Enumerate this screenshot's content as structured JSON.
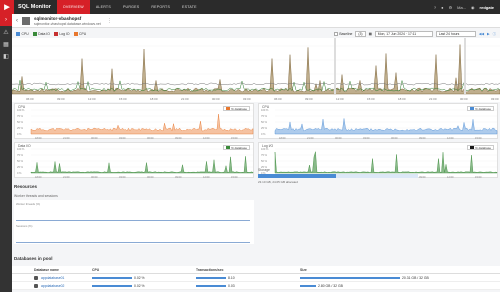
{
  "topbar": {
    "brand": "SQL Monitor",
    "nav": [
      "OVERVIEW",
      "ALERTS",
      "PURGES",
      "REPORTS",
      "ESTATE"
    ],
    "active_index": 0,
    "user": "Ma...",
    "company": "redgate"
  },
  "header": {
    "title": "sqlmonitor-vbashopsf",
    "subtitle": "sqlmonitor-vbashopsf.database.windows.net"
  },
  "toolbar": {
    "series": [
      {
        "label": "CPU",
        "color": "#4a8bd4"
      },
      {
        "label": "Data IO",
        "color": "#3a8a3a"
      },
      {
        "label": "Log IO",
        "color": "#c63030"
      },
      {
        "label": "CPU",
        "color": "#e8772e"
      }
    ],
    "baseline_label": "Baseline",
    "baseline_value": "(3)",
    "date_value": "Mon, 17 Jun 2024 · 17:11",
    "range_value": "Last 24 hours"
  },
  "overview_times": [
    "06:00",
    "09:00",
    "12:00",
    "15:00",
    "18:00",
    "21:00",
    "00:00",
    "03:00",
    "06:00",
    "09:00",
    "12:00",
    "15:00",
    "18:00",
    "21:00",
    "00:00",
    "03:00"
  ],
  "panels": {
    "cpu_left": {
      "title": "CPU",
      "legend": "% database",
      "color": "#e8772e",
      "yticks": [
        "100 %",
        "75 %",
        "50 %",
        "25 %",
        "0 %"
      ]
    },
    "cpu_right": {
      "title": "CPU",
      "legend": "% database",
      "color": "#4a8bd4",
      "yticks": [
        "100 %",
        "75 %",
        "50 %",
        "25 %",
        "0 %"
      ]
    },
    "data_io": {
      "title": "Data I/O",
      "legend": "% database",
      "color": "#3a8a3a",
      "yticks": [
        "100 %",
        "75 %",
        "50 %",
        "25 %",
        "0 %"
      ]
    },
    "log_io": {
      "title": "Log I/O",
      "legend": "% database",
      "color": "#3a8a3a",
      "yticks": [
        "100 %",
        "75 %",
        "50 %",
        "25 %",
        "0 %"
      ]
    }
  },
  "panel_times": [
    "18:00",
    "21:00",
    "00:00",
    "03:00",
    "06:00",
    "09:00",
    "12:00",
    "15:00"
  ],
  "resources": {
    "title": "Resources",
    "worker_title": "Worker threads and sessions",
    "worker_label_1": "Worker threads (%)",
    "worker_label_2": "Sessions (%)",
    "storage_title": "Storage",
    "storage_text": "23.10 GB, 24.05 GB allocated",
    "storage_fraction": 0.49
  },
  "databases": {
    "title": "Databases in pool",
    "columns": [
      "Database name",
      "CPU",
      "Transactions/sec",
      "Size"
    ],
    "rows": [
      {
        "name": "appdatabase01",
        "cpu": "0.02 %",
        "tps": "8.10",
        "size": "20.31 GB / 32 GB"
      },
      {
        "name": "appdatabase02",
        "cpu": "0.02 %",
        "tps": "0.03",
        "size": "2.80 GB / 32 GB"
      }
    ]
  }
}
